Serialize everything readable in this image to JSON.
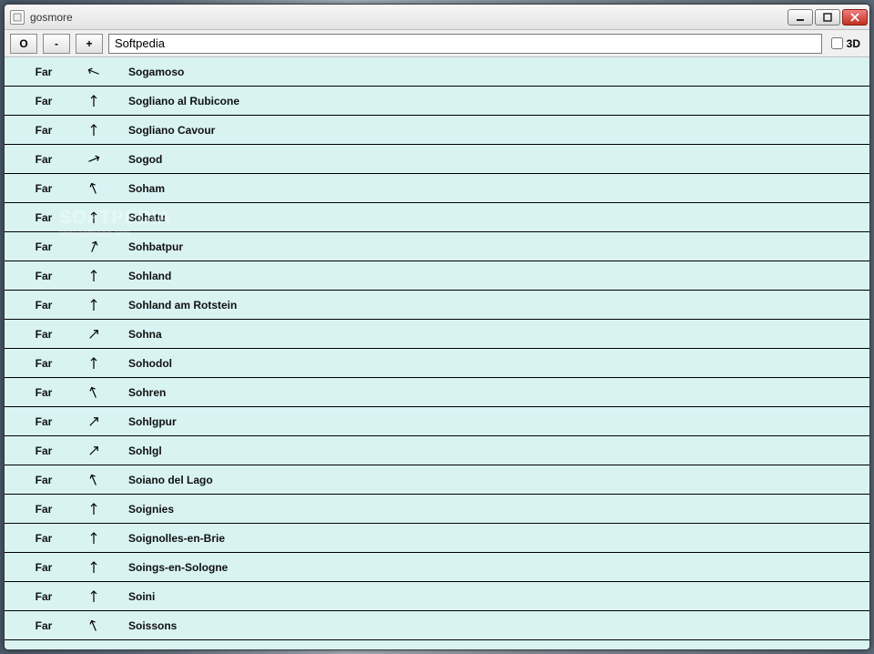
{
  "window": {
    "title": "gosmore"
  },
  "toolbar": {
    "orient_label": "O",
    "zoom_out_label": "-",
    "zoom_in_label": "+",
    "mode3d_label": "3D"
  },
  "search": {
    "value": "Softpedia",
    "placeholder": ""
  },
  "mode3d_checked": false,
  "results": [
    {
      "distance": "Far",
      "direction": "wnw",
      "name": "Sogamoso"
    },
    {
      "distance": "Far",
      "direction": "n",
      "name": "Sogliano al Rubicone"
    },
    {
      "distance": "Far",
      "direction": "n",
      "name": "Sogliano Cavour"
    },
    {
      "distance": "Far",
      "direction": "ene",
      "name": "Sogod"
    },
    {
      "distance": "Far",
      "direction": "nnw",
      "name": "Soham"
    },
    {
      "distance": "Far",
      "direction": "n",
      "name": "Sohatu"
    },
    {
      "distance": "Far",
      "direction": "nne",
      "name": "Sohbatpur"
    },
    {
      "distance": "Far",
      "direction": "n",
      "name": "Sohland"
    },
    {
      "distance": "Far",
      "direction": "n",
      "name": "Sohland am Rotstein"
    },
    {
      "distance": "Far",
      "direction": "ne",
      "name": "Sohna"
    },
    {
      "distance": "Far",
      "direction": "n",
      "name": "Sohodol"
    },
    {
      "distance": "Far",
      "direction": "nnw",
      "name": "Sohren"
    },
    {
      "distance": "Far",
      "direction": "ne",
      "name": "Sohlgpur"
    },
    {
      "distance": "Far",
      "direction": "ne",
      "name": "Sohlgl"
    },
    {
      "distance": "Far",
      "direction": "nnw",
      "name": "Soiano del Lago"
    },
    {
      "distance": "Far",
      "direction": "n",
      "name": "Soignies"
    },
    {
      "distance": "Far",
      "direction": "n",
      "name": "Soignolles-en-Brie"
    },
    {
      "distance": "Far",
      "direction": "n",
      "name": "Soings-en-Sologne"
    },
    {
      "distance": "Far",
      "direction": "n",
      "name": "Soini"
    },
    {
      "distance": "Far",
      "direction": "nnw",
      "name": "Soissons"
    }
  ],
  "watermark": {
    "brand": "SOFTPEDIA",
    "url": "www.softpedia.com"
  }
}
